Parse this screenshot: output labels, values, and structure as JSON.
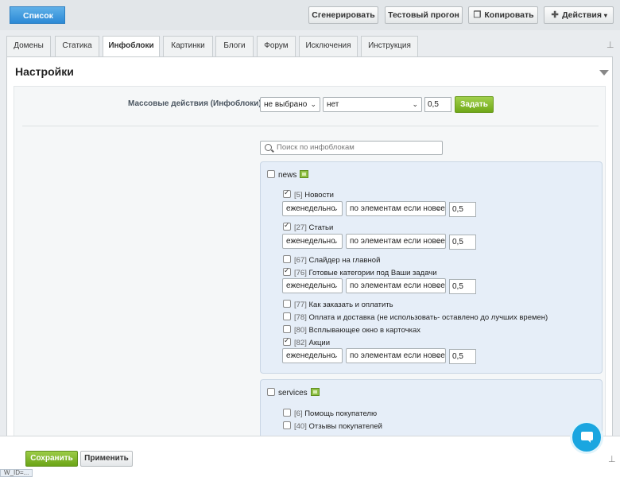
{
  "toolbar": {
    "back_label": "Список",
    "generate_label": "Сгенерировать",
    "test_label": "Тестовый прогон",
    "copy_label": "Копировать",
    "actions_label": "Действия"
  },
  "tabs": [
    {
      "label": "Домены"
    },
    {
      "label": "Статика"
    },
    {
      "label": "Инфоблоки",
      "active": true
    },
    {
      "label": "Картинки"
    },
    {
      "label": "Блоги"
    },
    {
      "label": "Форум"
    },
    {
      "label": "Исключения"
    },
    {
      "label": "Инструкция"
    }
  ],
  "panel": {
    "title": "Настройки"
  },
  "mass": {
    "label": "Массовые действия (Инфоблоки):",
    "select1": "не выбрано",
    "select2": "нет",
    "value": "0,5",
    "apply_label": "Задать"
  },
  "search": {
    "placeholder": "Поиск по инфоблокам"
  },
  "groups": [
    {
      "name": "news",
      "items": [
        {
          "id": "[5]",
          "label": "Новости",
          "checked": true,
          "freq": "еженедельно",
          "mode": "по элементам если новее",
          "priority": "0,5"
        },
        {
          "id": "[27]",
          "label": "Статьи",
          "checked": true,
          "freq": "еженедельно",
          "mode": "по элементам если новее",
          "priority": "0,5"
        },
        {
          "id": "[67]",
          "label": "Слайдер на главной",
          "checked": false
        },
        {
          "id": "[76]",
          "label": "Готовые категории под Ваши задачи",
          "checked": true,
          "freq": "еженедельно",
          "mode": "по элементам если новее",
          "priority": "0,5"
        },
        {
          "id": "[77]",
          "label": "Как заказать и оплатить",
          "checked": false
        },
        {
          "id": "[78]",
          "label": "Оплата и доставка (не использовать- оставлено до лучших времен)",
          "checked": false
        },
        {
          "id": "[80]",
          "label": "Всплывающее окно в карточках",
          "checked": false
        },
        {
          "id": "[82]",
          "label": "Акции",
          "checked": true,
          "freq": "еженедельно",
          "mode": "по элементам если новее",
          "priority": "0,5"
        }
      ]
    },
    {
      "name": "services",
      "items": [
        {
          "id": "[6]",
          "label": "Помощь покупателю",
          "checked": false
        },
        {
          "id": "[40]",
          "label": "Отзывы покупателей",
          "checked": false
        }
      ]
    }
  ],
  "bottom": {
    "save_label": "Сохранить",
    "apply_label": "Применить"
  },
  "status_text": "W_ID=..."
}
